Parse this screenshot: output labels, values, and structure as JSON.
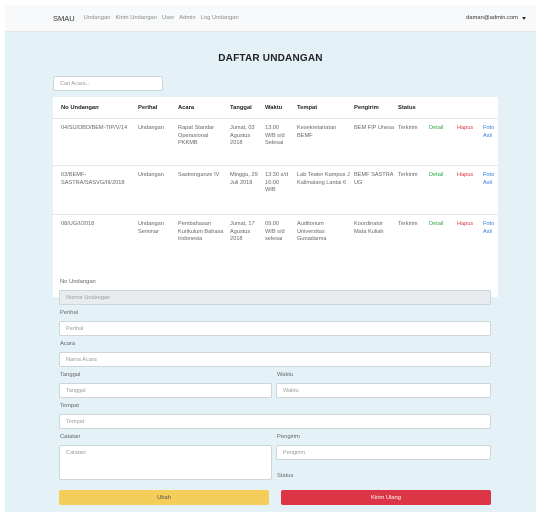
{
  "navbar": {
    "brand": "SMAU",
    "links": [
      "Undangan",
      "Kirim Undangan",
      "User",
      "Admin",
      "Log Undangan"
    ],
    "user": "daman@admin.com"
  },
  "page": {
    "title": "DAFTAR UNDANGAN",
    "search_placeholder": "Cari Acara..."
  },
  "table": {
    "headers": [
      "No Undangan",
      "Perihal",
      "Acara",
      "Tanggal",
      "Waktu",
      "Tempat",
      "Pengirim",
      "Status"
    ],
    "actions": {
      "detail": "Detail",
      "hapus": "Hapus",
      "foto": "Foto Asli"
    },
    "rows": [
      {
        "no": "04/SU/DBD/BEM-TIP/V/14",
        "perihal": "Undangan",
        "acara": "Rapat Standar Operasional PKKMB",
        "tanggal": "Jumat, 03 Agustus 2018",
        "waktu": "13:00 WIB s/d Selesai",
        "tempat": "Kesekretariatan BEMF",
        "pengirim": "BEM FIP Unesa",
        "status": "Terkirim"
      },
      {
        "no": "03/BEMF-SASTRA/SASVG/III/2018",
        "perihal": "Undangan",
        "acara": "Sastrenganze IV",
        "tanggal": "Minggu, 29 Juli 2018",
        "waktu": "13:30 s/d 16:00 WIB",
        "tempat": "Lab Teater Kampus J Kalimalang Lantai 6",
        "pengirim": "BEMF SASTRA UG",
        "status": "Terkirim"
      },
      {
        "no": "08/UG/I/2018",
        "perihal": "Undangan Seminar",
        "acara": "Pembahasan Kurikulum Bahasa Indonesia",
        "tanggal": "Jumat, 17 Agustus 2018",
        "waktu": "09:00 WIB s/d selesai",
        "tempat": "Auditorium Universitas Gunadarma",
        "pengirim": "Koordinator Mata Kuliah",
        "status": "Terkirim"
      }
    ]
  },
  "form": {
    "no_label": "No Undangan",
    "no_placeholder": "Nomor Undangan",
    "perihal_label": "Perihal",
    "perihal_placeholder": "Perihal",
    "acara_label": "Acara",
    "acara_placeholder": "Nama Acara",
    "tanggal_label": "Tanggal",
    "tanggal_placeholder": "Tanggal",
    "waktu_label": "Waktu",
    "waktu_placeholder": "Waktu",
    "tempat_label": "Tempat",
    "tempat_placeholder": "Tempat",
    "catatan_label": "Catatan",
    "catatan_placeholder": "Catatan",
    "pengirim_label": "Pengirim",
    "pengirim_placeholder": "Pengirim",
    "status_label": "Status",
    "ubah_button": "Ubah",
    "kirim_button": "Kirim Ulang"
  },
  "colors": {
    "background": "#e4f1f7",
    "detail": "#28a745",
    "hapus": "#dc3545",
    "foto": "#2f7ce0",
    "ubah_button": "#f5cd5b",
    "kirim_button": "#dc3545"
  }
}
